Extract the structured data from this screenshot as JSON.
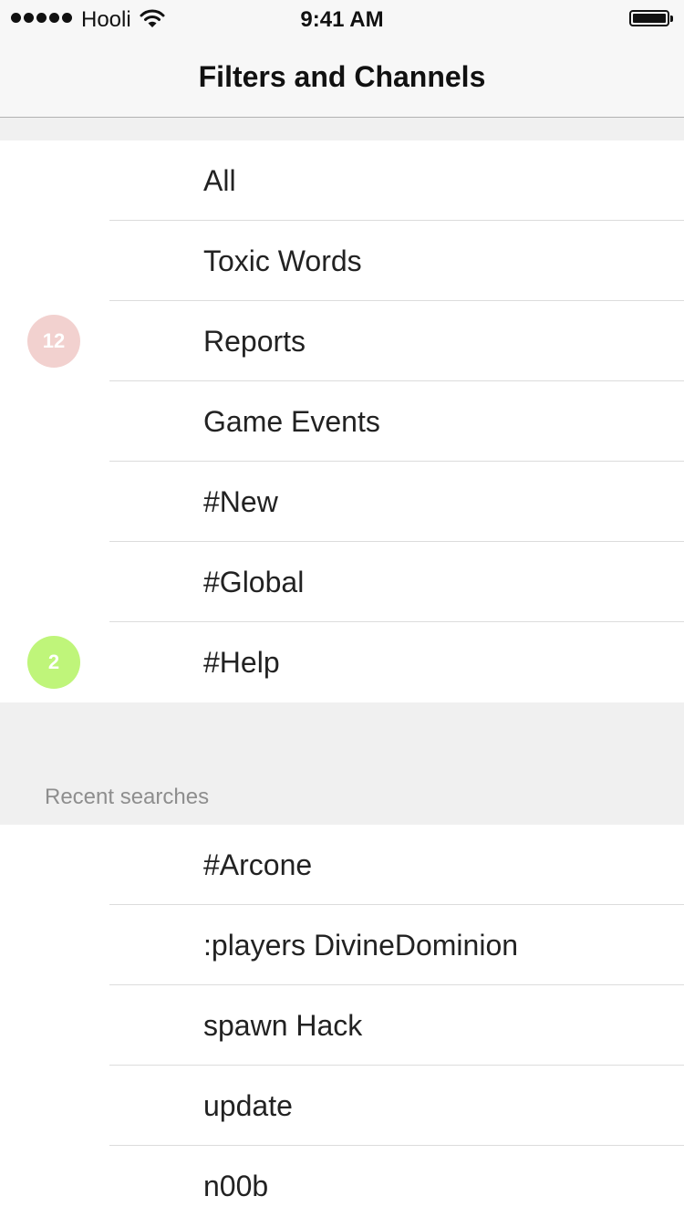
{
  "status_bar": {
    "carrier": "Hooli",
    "time": "9:41 AM"
  },
  "nav": {
    "title": "Filters and Channels"
  },
  "channels": [
    {
      "label": "All"
    },
    {
      "label": "Toxic Words"
    },
    {
      "label": "Reports",
      "badge": "12",
      "badge_color": "#f2d1cf"
    },
    {
      "label": "Game Events"
    },
    {
      "label": "#New"
    },
    {
      "label": "#Global"
    },
    {
      "label": "#Help",
      "badge": "2",
      "badge_color": "#bff57a"
    }
  ],
  "recent": {
    "header": "Recent searches",
    "items": [
      {
        "label": "#Arcone"
      },
      {
        "label": ":players DivineDominion"
      },
      {
        "label": "spawn Hack"
      },
      {
        "label": "update"
      },
      {
        "label": "n00b"
      }
    ]
  }
}
